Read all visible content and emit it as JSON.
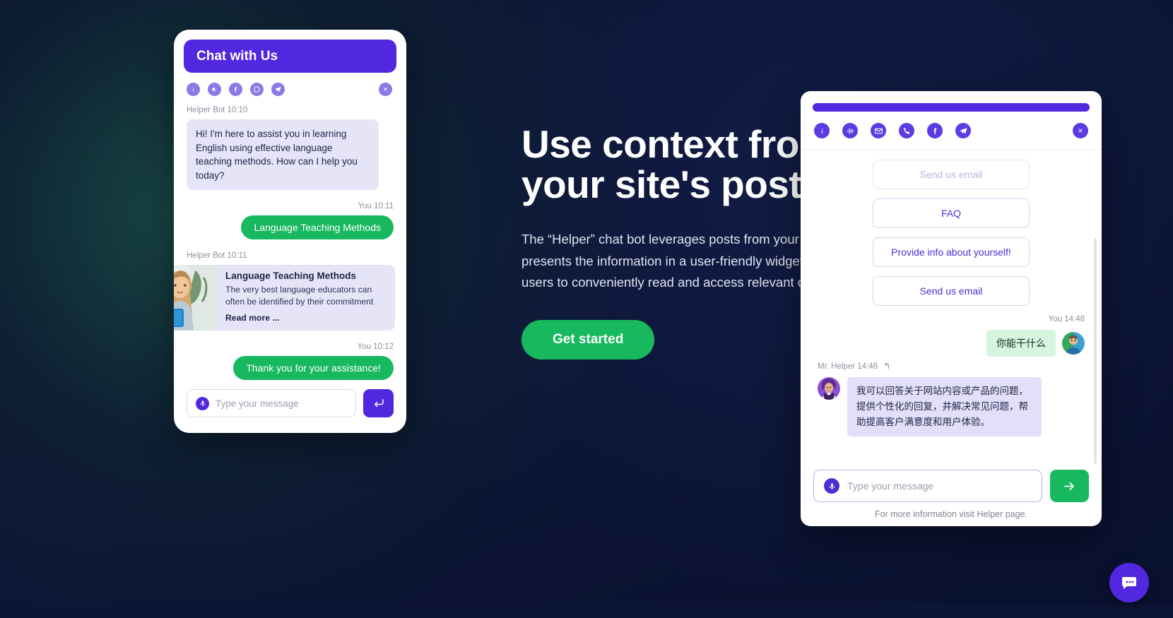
{
  "hero": {
    "title_line1": "Use context from",
    "title_line2": "your site's posts",
    "paragraph": "The “Helper” chat bot leverages posts from your website and presents the information in a user-friendly widget, enabling users to conveniently read and access relevant content.",
    "cta_label": "Get started"
  },
  "phone_widget": {
    "header_title": "Chat with Us",
    "icons": [
      {
        "name": "info-icon",
        "glyph": "i"
      },
      {
        "name": "voice-icon",
        "glyph": "◀"
      },
      {
        "name": "facebook-icon",
        "glyph": "f"
      },
      {
        "name": "whatsapp-icon",
        "glyph": "☎"
      },
      {
        "name": "telegram-icon",
        "glyph": "➤"
      }
    ],
    "close_label": "×",
    "messages": [
      {
        "meta": "Helper Bot 10:10",
        "text": "Hi! I'm here to assist you in learning English using effective language teaching methods. How can I help you today?",
        "side": "bot"
      },
      {
        "meta": "You 10:11",
        "text": "Language Teaching Methods",
        "side": "me"
      },
      {
        "meta": "Helper Bot 10:11",
        "side": "bot-card"
      },
      {
        "meta": "You 10:12",
        "text": "Thank you for your assistance!",
        "side": "me"
      }
    ],
    "card": {
      "title": "Language Teaching Methods",
      "text": "The very best language educators can often be identified by their commitment",
      "link": "Read more ..."
    },
    "input_placeholder": "Type your message",
    "send_icon": "enter-arrow-icon"
  },
  "chat_widget": {
    "icons": [
      {
        "name": "info-icon"
      },
      {
        "name": "voice-waveform-icon"
      },
      {
        "name": "email-icon"
      },
      {
        "name": "phone-icon"
      },
      {
        "name": "facebook-icon"
      },
      {
        "name": "telegram-icon"
      }
    ],
    "close_label": "×",
    "options": [
      {
        "label": "Send us email",
        "faded": true
      },
      {
        "label": "FAQ",
        "faded": false
      },
      {
        "label": "Provide info about yourself!",
        "faded": false
      },
      {
        "label": "Send us email",
        "faded": false
      }
    ],
    "user_message": {
      "meta": "You  14:48",
      "text": "你能干什么"
    },
    "bot_message": {
      "meta": "Mr. Helper 14:48",
      "reply_arrow": "↰",
      "text": "我可以回答关于网站内容或产品的问题，提供个性化的回复，并解决常见问题，帮助提高客户满意度和用户体验。"
    },
    "input_placeholder": "Type your message",
    "send_icon": "arrow-right-icon",
    "footer_note": "For more information visit Helper page."
  },
  "launcher": {
    "icon": "chat-bubble-icon"
  },
  "colors": {
    "primary": "#5127e0",
    "accent_green": "#18b85f",
    "background": "#0d1537",
    "bot_bubble": "#e6e4f7",
    "user_bubble_cn": "#d6f5de"
  }
}
